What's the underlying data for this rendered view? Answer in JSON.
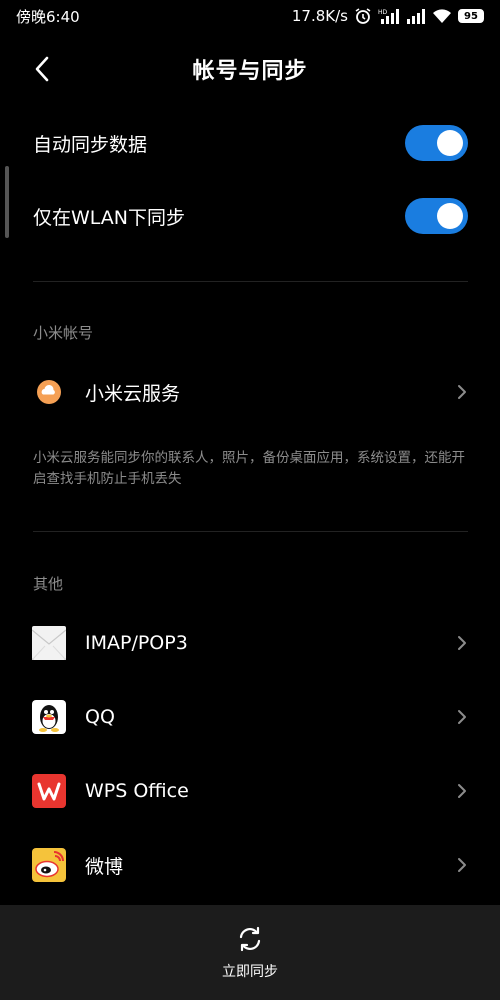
{
  "status_bar": {
    "time": "傍晚6:40",
    "net_speed": "17.8K/s",
    "battery": "95",
    "hd_label": "HD"
  },
  "header": {
    "title": "帐号与同步"
  },
  "toggles": [
    {
      "label": "自动同步数据",
      "on": true
    },
    {
      "label": "仅在WLAN下同步",
      "on": true
    }
  ],
  "mi_account": {
    "section_title": "小米帐号",
    "item_label": "小米云服务",
    "description": "小米云服务能同步你的联系人，照片，备份桌面应用，系统设置，还能开启查找手机防止手机丢失"
  },
  "others": {
    "section_title": "其他",
    "items": [
      {
        "label": "IMAP/POP3",
        "icon": "mail-icon"
      },
      {
        "label": "QQ",
        "icon": "qq-icon"
      },
      {
        "label": "WPS Office",
        "icon": "wps-icon"
      },
      {
        "label": "微博",
        "icon": "weibo-icon"
      }
    ]
  },
  "bottom": {
    "sync_now": "立即同步"
  },
  "colors": {
    "toggle_on": "#1a7de0",
    "mi_cloud": "#f5a054",
    "wps_red": "#e8352f",
    "weibo_yellow": "#f5c33b"
  }
}
